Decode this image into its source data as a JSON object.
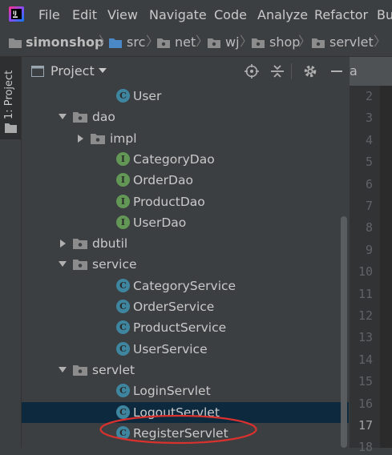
{
  "menu": [
    "File",
    "Edit",
    "View",
    "Navigate",
    "Code",
    "Analyze",
    "Refactor",
    "Bu"
  ],
  "breadcrumb": [
    "simonshop",
    "src",
    "net",
    "wj",
    "shop",
    "servlet"
  ],
  "tool_stripe": {
    "label": "1: Project"
  },
  "project_panel": {
    "title": "Project",
    "tree": [
      {
        "label": "User",
        "kind": "class",
        "expand": "none",
        "selected": false
      },
      {
        "label": "dao",
        "kind": "package",
        "expand": "down",
        "selected": false
      },
      {
        "label": "impl",
        "kind": "package",
        "expand": "right",
        "selected": false
      },
      {
        "label": "CategoryDao",
        "kind": "interface",
        "expand": "none",
        "selected": false
      },
      {
        "label": "OrderDao",
        "kind": "interface",
        "expand": "none",
        "selected": false
      },
      {
        "label": "ProductDao",
        "kind": "interface",
        "expand": "none",
        "selected": false
      },
      {
        "label": "UserDao",
        "kind": "interface",
        "expand": "none",
        "selected": false
      },
      {
        "label": "dbutil",
        "kind": "package",
        "expand": "right",
        "selected": false
      },
      {
        "label": "service",
        "kind": "package",
        "expand": "down",
        "selected": false
      },
      {
        "label": "CategoryService",
        "kind": "class",
        "expand": "none",
        "selected": false
      },
      {
        "label": "OrderService",
        "kind": "class",
        "expand": "none",
        "selected": false
      },
      {
        "label": "ProductService",
        "kind": "class",
        "expand": "none",
        "selected": false
      },
      {
        "label": "UserService",
        "kind": "class",
        "expand": "none",
        "selected": false
      },
      {
        "label": "servlet",
        "kind": "package",
        "expand": "down",
        "selected": false
      },
      {
        "label": "LoginServlet",
        "kind": "class",
        "expand": "none",
        "selected": false
      },
      {
        "label": "LogoutServlet",
        "kind": "class",
        "expand": "none",
        "selected": true
      },
      {
        "label": "RegisterServlet",
        "kind": "class",
        "expand": "none",
        "selected": false
      }
    ]
  },
  "editor": {
    "tab_label": "a",
    "line_numbers": [
      "2",
      "3",
      "4",
      "5",
      "6",
      "7",
      "8",
      "9",
      "10",
      "11",
      "12",
      "13",
      "14",
      "15",
      "16",
      "17",
      "18"
    ],
    "current_line": "17"
  },
  "badge_letters": {
    "class": "C",
    "interface": "I"
  },
  "colors": {
    "background": "#3c3f41",
    "selection": "#0d293e",
    "class_badge": "#3e86a0",
    "interface_badge": "#629755",
    "annotation_ellipse": "#d9312d"
  }
}
